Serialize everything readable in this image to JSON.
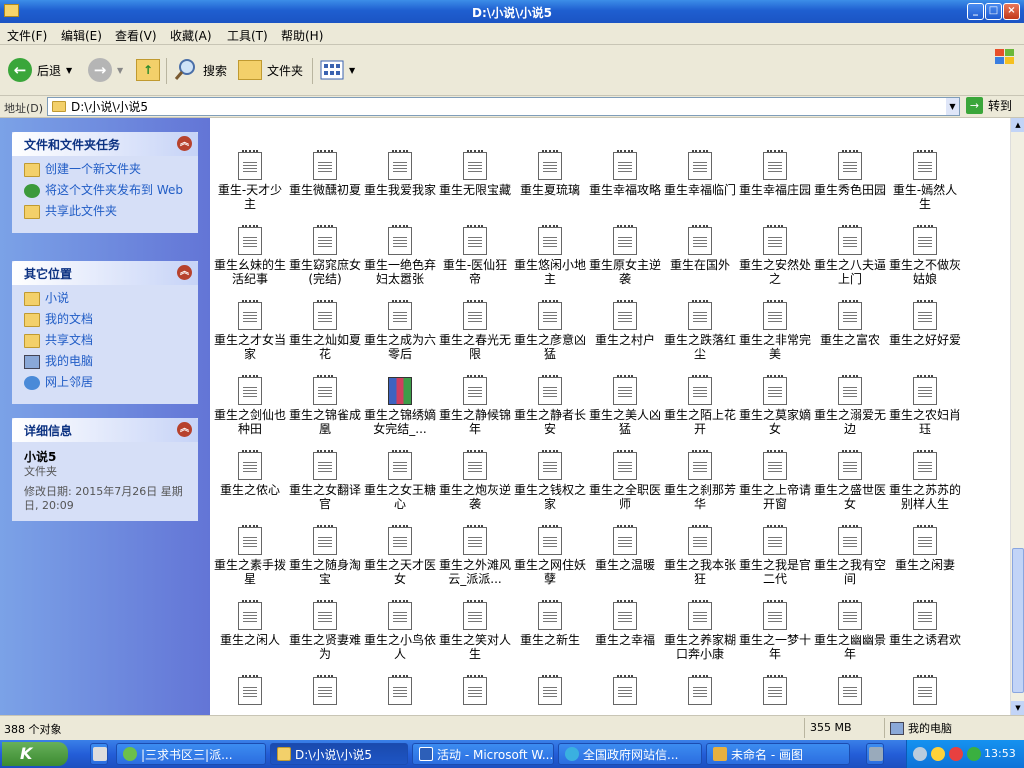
{
  "window": {
    "title": "D:\\小说\\小说5"
  },
  "menu": [
    "文件(F)",
    "编辑(E)",
    "查看(V)",
    "收藏(A)",
    "工具(T)",
    "帮助(H)"
  ],
  "toolbar": {
    "back": "后退",
    "search": "搜索",
    "folders": "文件夹"
  },
  "address": {
    "label": "地址(D)",
    "path": "D:\\小说\\小说5",
    "go": "转到"
  },
  "tasks_panel": {
    "title": "文件和文件夹任务",
    "items": [
      "创建一个新文件夹",
      "将这个文件夹发布到 Web",
      "共享此文件夹"
    ]
  },
  "places_panel": {
    "title": "其它位置",
    "items": [
      "小说",
      "我的文档",
      "共享文档",
      "我的电脑",
      "网上邻居"
    ]
  },
  "details_panel": {
    "title": "详细信息",
    "name": "小说5",
    "type": "文件夹",
    "modified": "修改日期: 2015年7月26日 星期日, 20:09"
  },
  "files": [
    [
      "重生-天才少主",
      "重生微醺初夏",
      "重生我爱我家",
      "重生无限宝藏",
      "重生夏琉璃",
      "重生幸福攻略",
      "重生幸福临门",
      "重生幸福庄园",
      "重生秀色田园",
      "重生-嫣然人生"
    ],
    [
      "重生幺妹的生活纪事",
      "重生窈窕庶女(完结)",
      "重生一绝色弃妇太嚣张",
      "重生-医仙狂帝",
      "重生悠闲小地主",
      "重生原女主逆袭",
      "重生在国外",
      "重生之安然处之",
      "重生之八夫逼上门",
      "重生之不做灰姑娘"
    ],
    [
      "重生之才女当家",
      "重生之灿如夏花",
      "重生之成为六零后",
      "重生之春光无限",
      "重生之彦意凶猛",
      "重生之村户",
      "重生之跌落红尘",
      "重生之非常完美",
      "重生之富农",
      "重生之好好爱"
    ],
    [
      "重生之剑仙也种田",
      "重生之锦雀成凰",
      "重生之锦绣嫡女完结_...",
      "重生之静候锦年",
      "重生之静者长安",
      "重生之美人凶猛",
      "重生之陌上花开",
      "重生之莫家嫡女",
      "重生之溺爱无边",
      "重生之农妇肖珏"
    ],
    [
      "重生之侬心",
      "重生之女翻译官",
      "重生之女王糖心",
      "重生之炮灰逆袭",
      "重生之钱权之家",
      "重生之全职医师",
      "重生之刹那芳华",
      "重生之上帝请开窗",
      "重生之盛世医女",
      "重生之苏苏的别样人生"
    ],
    [
      "重生之素手拨星",
      "重生之随身淘宝",
      "重生之天才医女",
      "重生之外滩风云_派派...",
      "重生之网住妖孽",
      "重生之温暖",
      "重生之我本张狂",
      "重生之我是官二代",
      "重生之我有空间",
      "重生之闲妻"
    ],
    [
      "重生之闲人",
      "重生之贤妻难为",
      "重生之小鸟依人",
      "重生之笑对人生",
      "重生之新生",
      "重生之幸福",
      "重生之养家糊口奔小康",
      "重生之一梦十年",
      "重生之幽幽景年",
      "重生之诱君欢"
    ]
  ],
  "status": {
    "count": "388 个对象",
    "size": "355 MB",
    "location": "我的电脑"
  },
  "taskbar": {
    "tasks": [
      "|三求书区三|派...",
      "D:\\小说\\小说5",
      "活动 - Microsoft W...",
      "全国政府网站信...",
      "未命名 - 画图"
    ],
    "clock": "13:53"
  }
}
